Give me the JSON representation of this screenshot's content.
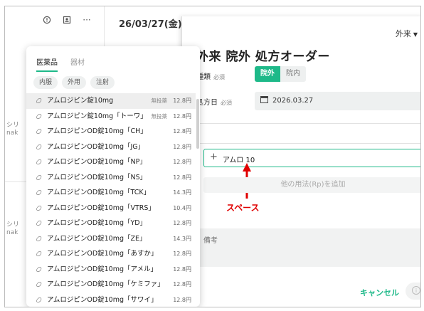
{
  "background": {
    "date_header": "26/03/27(金)",
    "side_snippets": [
      "シリ",
      "nak",
      "シリ",
      "nak"
    ]
  },
  "modal": {
    "visit_type": "外来",
    "title": "外来 院外 処方オーダー",
    "type_label": "種類",
    "type_required": "必須",
    "type_options": [
      "院外",
      "院内"
    ],
    "date_label": "処方日",
    "date_required": "必須",
    "date_value": "2026.03.27",
    "rp_input_value": "アムロ 10",
    "add_rp_label": "他の用法(Rp)を追加",
    "note_label": "備考",
    "cancel_label": "キャンセル"
  },
  "annotation": {
    "text": "スペース",
    "color": "#e00000"
  },
  "dropdown": {
    "tabs": [
      "医薬品",
      "器材"
    ],
    "chips": [
      "内服",
      "外用",
      "注射"
    ],
    "items": [
      {
        "name": "アムロジピン錠10mg",
        "tag": "無投薬",
        "price": "12.8円"
      },
      {
        "name": "アムロジピン錠10mg「トーワ」",
        "tag": "無投薬",
        "price": "12.8円"
      },
      {
        "name": "アムロジピンOD錠10mg「CH」",
        "tag": "",
        "price": "12.8円"
      },
      {
        "name": "アムロジピンOD錠10mg「JG」",
        "tag": "",
        "price": "12.8円"
      },
      {
        "name": "アムロジピンOD錠10mg「NP」",
        "tag": "",
        "price": "12.8円"
      },
      {
        "name": "アムロジピンOD錠10mg「NS」",
        "tag": "",
        "price": "12.8円"
      },
      {
        "name": "アムロジピンOD錠10mg「TCK」",
        "tag": "",
        "price": "14.3円"
      },
      {
        "name": "アムロジピンOD錠10mg「VTRS」",
        "tag": "",
        "price": "10.4円"
      },
      {
        "name": "アムロジピンOD錠10mg「YD」",
        "tag": "",
        "price": "12.8円"
      },
      {
        "name": "アムロジピンOD錠10mg「ZE」",
        "tag": "",
        "price": "14.3円"
      },
      {
        "name": "アムロジピンOD錠10mg「あすか」",
        "tag": "",
        "price": "12.8円"
      },
      {
        "name": "アムロジピンOD錠10mg「アメル」",
        "tag": "",
        "price": "12.8円"
      },
      {
        "name": "アムロジピンOD錠10mg「ケミファ」",
        "tag": "",
        "price": "12.8円"
      },
      {
        "name": "アムロジピンOD錠10mg「サワイ」",
        "tag": "",
        "price": "12.8円"
      }
    ]
  },
  "colors": {
    "accent": "#1eb989",
    "annotation": "#e00000"
  }
}
